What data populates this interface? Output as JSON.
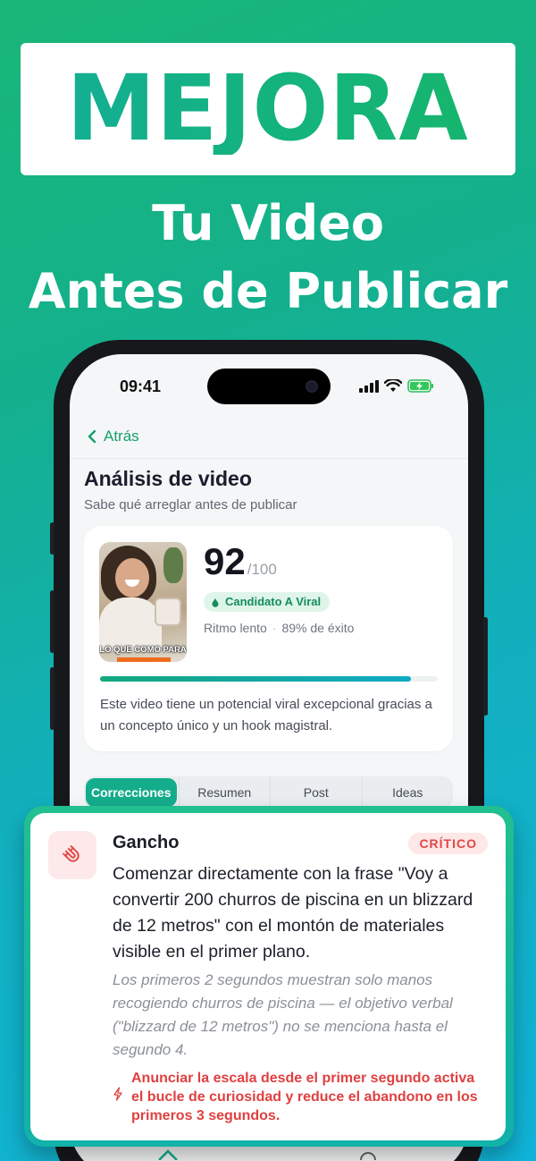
{
  "hero": {
    "title": "MEJORA",
    "subtitle_line1": "Tu Video",
    "subtitle_line2": "Antes de Publicar"
  },
  "status_bar": {
    "time": "09:41"
  },
  "nav": {
    "back_label": "Atrás"
  },
  "page": {
    "title": "Análisis de video",
    "subtitle": "Sabe qué arreglar antes de publicar"
  },
  "video_card": {
    "thumbnail_caption": "LO QUE COMO PARA",
    "score": "92",
    "score_max": "/100",
    "badge": "Candidato A Viral",
    "pace": "Ritmo lento",
    "success": "89% de éxito",
    "progress_fraction": 0.92,
    "description": "Este video tiene un potencial viral excepcional gracias a un concepto único y un hook magistral."
  },
  "tabs": [
    {
      "label": "Correcciones",
      "active": true
    },
    {
      "label": "Resumen",
      "active": false
    },
    {
      "label": "Post",
      "active": false
    },
    {
      "label": "Ideas",
      "active": false
    }
  ],
  "correction": {
    "icon": "magnet-icon",
    "title": "Gancho",
    "badge": "CRÍTICO",
    "body": "Comenzar directamente con la frase \"Voy a convertir 200 churros de piscina en un blizzard de 12 metros\" con el montón de materiales visible en el primer plano.",
    "note": "Los primeros 2 segundos muestran solo manos recogiendo churros de piscina — el objetivo verbal (\"blizzard de 12 metros\") no se menciona hasta el segundo 4.",
    "tip_icon": "lightning-icon",
    "tip": "Anunciar la escala desde el primer segundo activa el bucle de curiosidad y reduce el abandono en los primeros 3 segundos."
  },
  "colors": {
    "accent": "#14ad8c",
    "brand_green": "#16b56e",
    "critical": "#e04747"
  }
}
